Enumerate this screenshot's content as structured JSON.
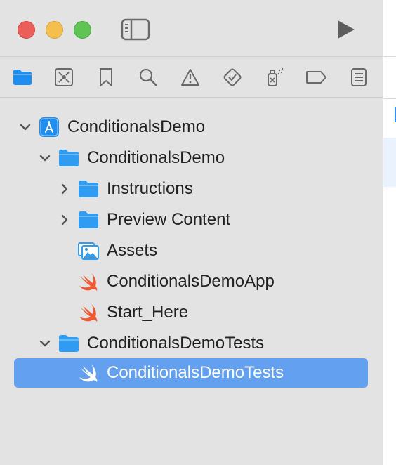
{
  "colors": {
    "sidebar_bg": "#e3e3e3",
    "accent": "#1f8ef1",
    "selection": "#63a0f0",
    "folder": "#2f9cf2",
    "swift": "#ef5a33",
    "icon_gray": "#6a6a6a"
  },
  "toolbar": {
    "icons": [
      "close-window",
      "minimize-window",
      "zoom-window",
      "sidebar-toggle-icon",
      "run-play-icon"
    ]
  },
  "navigator_tabs": [
    {
      "icon": "folder-icon",
      "active": true
    },
    {
      "icon": "source-control-icon",
      "active": false
    },
    {
      "icon": "bookmark-icon",
      "active": false
    },
    {
      "icon": "search-icon",
      "active": false
    },
    {
      "icon": "warning-icon",
      "active": false
    },
    {
      "icon": "test-diamond-icon",
      "active": false
    },
    {
      "icon": "debug-spray-icon",
      "active": false
    },
    {
      "icon": "breakpoint-tag-icon",
      "active": false
    },
    {
      "icon": "report-list-icon",
      "active": false
    }
  ],
  "tree": {
    "items": [
      {
        "label": "ConditionalsDemo",
        "icon": "app-project-icon",
        "expanded": true,
        "level": 0
      },
      {
        "label": "ConditionalsDemo",
        "icon": "folder-icon",
        "expanded": true,
        "level": 1
      },
      {
        "label": "Instructions",
        "icon": "folder-icon",
        "expanded": false,
        "level": 2
      },
      {
        "label": "Preview Content",
        "icon": "folder-icon",
        "expanded": false,
        "level": 2
      },
      {
        "label": "Assets",
        "icon": "asset-catalog-icon",
        "level": 2
      },
      {
        "label": "ConditionalsDemoApp",
        "icon": "swift-file-icon",
        "level": 2
      },
      {
        "label": "Start_Here",
        "icon": "swift-file-icon",
        "level": 2
      },
      {
        "label": "ConditionalsDemoTests",
        "icon": "folder-icon",
        "expanded": true,
        "level": 1
      },
      {
        "label": "ConditionalsDemoTests",
        "icon": "swift-file-icon",
        "level": 2,
        "selected": true
      }
    ]
  }
}
